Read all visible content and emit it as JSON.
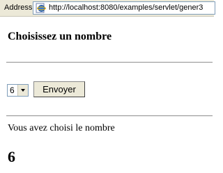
{
  "browser": {
    "address_label": "Address",
    "url": "http://localhost:8080/examples/servlet/gener3",
    "icon": "ie-page-icon"
  },
  "page": {
    "heading": "Choisissez un nombre",
    "select": {
      "selected_value": "6"
    },
    "submit_label": "Envoyer",
    "result_label": "Vous avez choisi le nombre",
    "result_value": "6"
  }
}
